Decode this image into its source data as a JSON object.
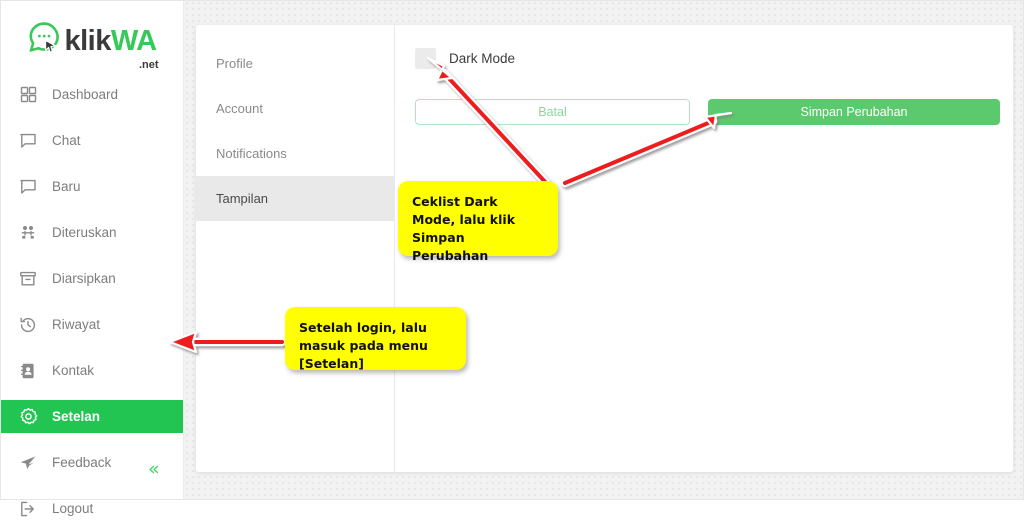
{
  "brand": {
    "name_part1": "klik",
    "name_part2": "WA",
    "tld": ".net",
    "logo_icon": "whatsapp-cursor-bubble-icon",
    "green": "#37c85a",
    "dark": "#3a3a3a"
  },
  "sidebar": {
    "collapse_icon": "«",
    "items": [
      {
        "label": "Dashboard",
        "icon": "grid-icon",
        "active": false
      },
      {
        "label": "Chat",
        "icon": "chat-bubble-icon",
        "active": false
      },
      {
        "label": "Baru",
        "icon": "chat-bubble-icon",
        "active": false
      },
      {
        "label": "Diteruskan",
        "icon": "users-icon",
        "active": false
      },
      {
        "label": "Diarsipkan",
        "icon": "archive-icon",
        "active": false
      },
      {
        "label": "Riwayat",
        "icon": "history-icon",
        "active": false
      },
      {
        "label": "Kontak",
        "icon": "contact-book-icon",
        "active": false
      },
      {
        "label": "Setelan",
        "icon": "gear-icon",
        "active": true
      },
      {
        "label": "Feedback",
        "icon": "paper-plane-icon",
        "active": false
      },
      {
        "label": "Logout",
        "icon": "sign-out-icon",
        "active": false
      }
    ],
    "active_color": "#23c552"
  },
  "settings": {
    "submenu": [
      {
        "label": "Profile",
        "active": false
      },
      {
        "label": "Account",
        "active": false
      },
      {
        "label": "Notifications",
        "active": false
      },
      {
        "label": "Tampilan",
        "active": true
      }
    ],
    "dark_mode": {
      "label": "Dark Mode",
      "checked": false
    },
    "buttons": {
      "cancel": "Batal",
      "save": "Simpan Perubahan",
      "save_color": "#5bc96e",
      "cancel_border_color": "#b3e3bd"
    }
  },
  "annotations": {
    "callout_dark_mode": "Ceklist Dark Mode, lalu klik Simpan Perubahan",
    "callout_setelan": "Setelah login, lalu masuk pada menu [Setelan]",
    "arrow_color": "#ee1c1c",
    "callout_color": "#ffff00"
  }
}
